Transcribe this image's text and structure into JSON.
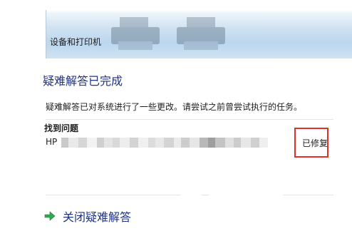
{
  "banner": {
    "breadcrumb": "设备和打印机"
  },
  "heading": "疑难解答已完成",
  "description": "疑难解答已对系统进行了一些更改。请尝试之前曾尝试执行的任务。",
  "problems": {
    "title": "找到问题",
    "items": [
      {
        "name": "HP",
        "status": "已修复"
      }
    ]
  },
  "actions": {
    "close_label": "关闭疑难解答"
  },
  "colors": {
    "heading": "#1e3287",
    "highlight": "#e0302a",
    "arrow": "#2fa84f"
  },
  "icons": {
    "close_arrow": "green-arrow-icon",
    "printer": "printer-icon"
  }
}
